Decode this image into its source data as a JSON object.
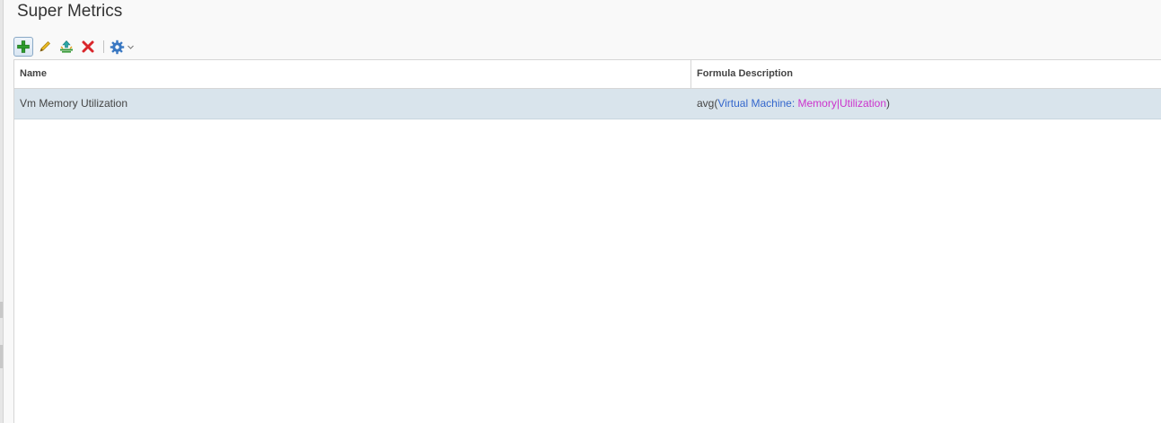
{
  "page": {
    "title": "Super Metrics"
  },
  "toolbar": {
    "buttons": [
      {
        "icon": "plus-icon",
        "color": "#2e9e2e"
      },
      {
        "icon": "pencil-icon",
        "color": "#d4a017"
      },
      {
        "icon": "import-icon",
        "color": "#2aa7a7"
      },
      {
        "icon": "delete-x-icon",
        "color": "#d9262b"
      },
      {
        "icon": "gear-icon",
        "color": "#3a78c2"
      }
    ]
  },
  "grid": {
    "columns": [
      "Name",
      "Formula Description"
    ],
    "rows": [
      {
        "name": "Vm Memory Utilization",
        "formula": {
          "func_open": "avg(",
          "object": "Virtual Machine: ",
          "metric_group": "Memory",
          "separator": "|",
          "metric": "Utilization",
          "close": ")"
        }
      }
    ],
    "selected_row_color": "#d9e4ec"
  },
  "colors": {
    "object_text": "#3366cc",
    "metric_text": "#cc33cc"
  }
}
